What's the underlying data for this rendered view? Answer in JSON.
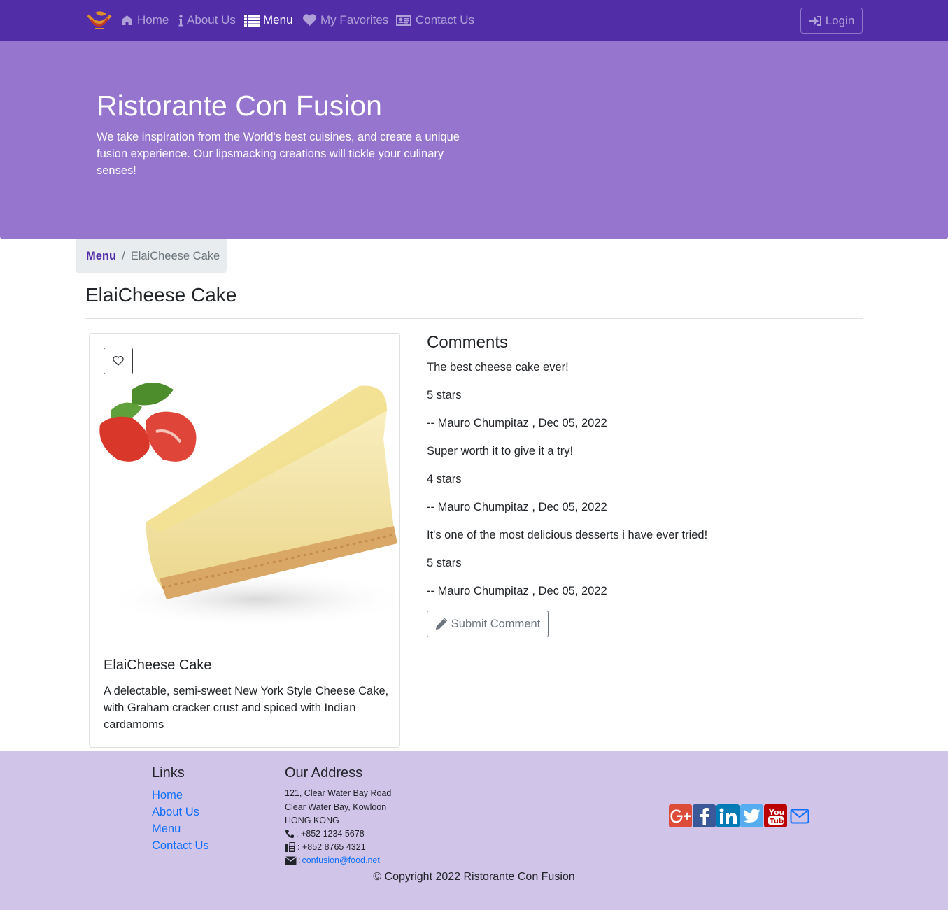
{
  "nav": {
    "items": [
      {
        "label": "Home",
        "icon": "home-icon"
      },
      {
        "label": "About Us",
        "icon": "info-icon"
      },
      {
        "label": "Menu",
        "icon": "list-icon"
      },
      {
        "label": "My Favorites",
        "icon": "heart-icon"
      },
      {
        "label": "Contact Us",
        "icon": "address-card-icon"
      }
    ],
    "login_label": "Login",
    "active": "Menu"
  },
  "jumbotron": {
    "title": "Ristorante Con Fusion",
    "text": "We take inspiration from the World's best cuisines, and create a unique fusion experience. Our lipsmacking creations will tickle your culinary senses!"
  },
  "breadcrumb": {
    "link": "Menu",
    "separator": "/",
    "active": "ElaiCheese Cake"
  },
  "dish": {
    "heading": "ElaiCheese Cake",
    "name": "ElaiCheese Cake",
    "description": "A delectable, semi-sweet New York Style Cheese Cake, with Graham cracker crust and spiced with Indian cardamoms"
  },
  "comments": {
    "title": "Comments",
    "items": [
      {
        "text": "The best cheese cake ever!",
        "rating": "5 stars",
        "author": "-- Mauro Chumpitaz , Dec 05, 2022"
      },
      {
        "text": "Super worth it to give it a try!",
        "rating": "4 stars",
        "author": "-- Mauro Chumpitaz , Dec 05, 2022"
      },
      {
        "text": "It's one of the most delicious desserts i have ever tried!",
        "rating": "5 stars",
        "author": "-- Mauro Chumpitaz , Dec 05, 2022"
      }
    ],
    "submit_label": "Submit Comment"
  },
  "footer": {
    "links_heading": "Links",
    "links": [
      "Home",
      "About Us",
      "Menu",
      "Contact Us"
    ],
    "address_heading": "Our Address",
    "address_lines": [
      "121, Clear Water Bay Road",
      "Clear Water Bay, Kowloon",
      "HONG KONG"
    ],
    "phone": ": +852 1234 5678",
    "fax": ": +852 8765 4321",
    "email_prefix": ":",
    "email": "confusion@food.net",
    "social": [
      "google-plus-icon",
      "facebook-icon",
      "linkedin-icon",
      "twitter-icon",
      "youtube-icon",
      "mail-icon"
    ],
    "copyright": "© Copyright 2022 Ristorante Con Fusion"
  },
  "colors": {
    "primary": "#512DA8",
    "jumbotron": "#9575CD",
    "footer": "#D1C4E9",
    "link": "#0d6efd"
  }
}
